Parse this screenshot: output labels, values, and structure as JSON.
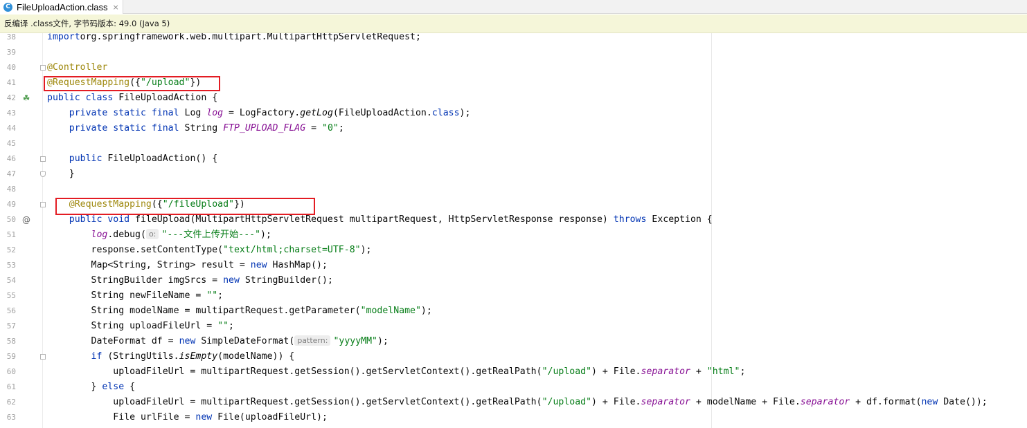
{
  "tab": {
    "title": "FileUploadAction.class",
    "icon": "class-file-icon",
    "close_glyph": "×"
  },
  "banner": {
    "text": "反编译 .class文件, 字节码版本: 49.0 (Java 5)"
  },
  "colors": {
    "keyword": "#0033b3",
    "annotation": "#9e880d",
    "string": "#067d17",
    "field": "#871094",
    "highlight_box": "#e31c23",
    "banner_bg": "#f5f6d9"
  },
  "editor": {
    "lines": [
      {
        "n": "38",
        "tokens": [
          [
            "kw",
            "import"
          ],
          [
            "",
            "org.springframework.web.multipart.MultipartHttpServletRequest;"
          ]
        ]
      },
      {
        "n": "39",
        "tokens": []
      },
      {
        "n": "40",
        "tokens": [
          [
            "ann",
            "@Controller"
          ]
        ]
      },
      {
        "n": "41",
        "tokens": [
          [
            "ann",
            "@RequestMapping"
          ],
          [
            "",
            "({"
          ],
          [
            "str",
            "\"/upload\""
          ],
          [
            "",
            "})"
          ]
        ]
      },
      {
        "n": "42",
        "tokens": [
          [
            "kw",
            "public class"
          ],
          [
            "",
            " FileUploadAction {"
          ]
        ]
      },
      {
        "n": "43",
        "tokens": [
          [
            "",
            "    "
          ],
          [
            "kw",
            "private static final"
          ],
          [
            "",
            " Log "
          ],
          [
            "fld",
            "log"
          ],
          [
            "",
            " = LogFactory."
          ],
          [
            "itm",
            "getLog"
          ],
          [
            "",
            "(FileUploadAction."
          ],
          [
            "kw",
            "class"
          ],
          [
            "",
            ");"
          ]
        ]
      },
      {
        "n": "44",
        "tokens": [
          [
            "",
            "    "
          ],
          [
            "kw",
            "private static final"
          ],
          [
            "",
            " String "
          ],
          [
            "sfld",
            "FTP_UPLOAD_FLAG"
          ],
          [
            "",
            " = "
          ],
          [
            "str",
            "\"0\""
          ],
          [
            "",
            ";"
          ]
        ]
      },
      {
        "n": "45",
        "tokens": []
      },
      {
        "n": "46",
        "tokens": [
          [
            "",
            "    "
          ],
          [
            "kw",
            "public"
          ],
          [
            "",
            " FileUploadAction() {"
          ]
        ]
      },
      {
        "n": "47",
        "tokens": [
          [
            "",
            "    }"
          ]
        ]
      },
      {
        "n": "48",
        "tokens": []
      },
      {
        "n": "49",
        "tokens": [
          [
            "",
            "    "
          ],
          [
            "ann",
            "@RequestMapping"
          ],
          [
            "",
            "({"
          ],
          [
            "str",
            "\"/fileUpload\""
          ],
          [
            "",
            "})"
          ]
        ]
      },
      {
        "n": "50",
        "tokens": [
          [
            "",
            "    "
          ],
          [
            "kw",
            "public void"
          ],
          [
            "",
            " fileUpload(MultipartHttpServletRequest multipartRequest, HttpServletResponse response) "
          ],
          [
            "kw",
            "throws"
          ],
          [
            "",
            " Exception {"
          ]
        ]
      },
      {
        "n": "51",
        "tokens": [
          [
            "",
            "        "
          ],
          [
            "fld",
            "log"
          ],
          [
            "",
            ".debug("
          ],
          [
            "hint",
            "o:"
          ],
          [
            "str",
            "\"---文件上传开始---\""
          ],
          [
            "",
            ");"
          ]
        ]
      },
      {
        "n": "52",
        "tokens": [
          [
            "",
            "        response.setContentType("
          ],
          [
            "str",
            "\"text/html;charset=UTF-8\""
          ],
          [
            "",
            ");"
          ]
        ]
      },
      {
        "n": "53",
        "tokens": [
          [
            "",
            "        Map<String, String> result = "
          ],
          [
            "kw",
            "new"
          ],
          [
            "",
            " HashMap();"
          ]
        ]
      },
      {
        "n": "54",
        "tokens": [
          [
            "",
            "        StringBuilder imgSrcs = "
          ],
          [
            "kw",
            "new"
          ],
          [
            "",
            " StringBuilder();"
          ]
        ]
      },
      {
        "n": "55",
        "tokens": [
          [
            "",
            "        String newFileName = "
          ],
          [
            "str",
            "\"\""
          ],
          [
            "",
            ";"
          ]
        ]
      },
      {
        "n": "56",
        "tokens": [
          [
            "",
            "        String modelName = multipartRequest.getParameter("
          ],
          [
            "str",
            "\"modelName\""
          ],
          [
            "",
            ");"
          ]
        ]
      },
      {
        "n": "57",
        "tokens": [
          [
            "",
            "        String uploadFileUrl = "
          ],
          [
            "str",
            "\"\""
          ],
          [
            "",
            ";"
          ]
        ]
      },
      {
        "n": "58",
        "tokens": [
          [
            "",
            "        DateFormat df = "
          ],
          [
            "kw",
            "new"
          ],
          [
            "",
            " SimpleDateFormat("
          ],
          [
            "hint",
            "pattern:"
          ],
          [
            "str",
            "\"yyyyMM\""
          ],
          [
            "",
            ");"
          ]
        ]
      },
      {
        "n": "59",
        "tokens": [
          [
            "",
            "        "
          ],
          [
            "kw",
            "if"
          ],
          [
            "",
            " (StringUtils."
          ],
          [
            "itm",
            "isEmpty"
          ],
          [
            "",
            "(modelName)) {"
          ]
        ]
      },
      {
        "n": "60",
        "tokens": [
          [
            "",
            "            uploadFileUrl = multipartRequest.getSession().getServletContext().getRealPath("
          ],
          [
            "str",
            "\"/upload\""
          ],
          [
            "",
            ") + File."
          ],
          [
            "sfld",
            "separator"
          ],
          [
            "",
            " + "
          ],
          [
            "str",
            "\"html\""
          ],
          [
            "",
            ";"
          ]
        ]
      },
      {
        "n": "61",
        "tokens": [
          [
            "",
            "        } "
          ],
          [
            "kw",
            "else"
          ],
          [
            "",
            " {"
          ]
        ]
      },
      {
        "n": "62",
        "tokens": [
          [
            "",
            "            uploadFileUrl = multipartRequest.getSession().getServletContext().getRealPath("
          ],
          [
            "str",
            "\"/upload\""
          ],
          [
            "",
            ") + File."
          ],
          [
            "sfld",
            "separator"
          ],
          [
            "",
            " + modelName + File."
          ],
          [
            "sfld",
            "separator"
          ],
          [
            "",
            " + df.format("
          ],
          [
            "kw",
            "new"
          ],
          [
            "",
            " Date());"
          ]
        ]
      },
      {
        "n": "63",
        "tokens": [
          [
            "",
            "            File urlFile = "
          ],
          [
            "kw",
            "new"
          ],
          [
            "",
            " File(uploadFileUrl);"
          ]
        ]
      }
    ]
  }
}
